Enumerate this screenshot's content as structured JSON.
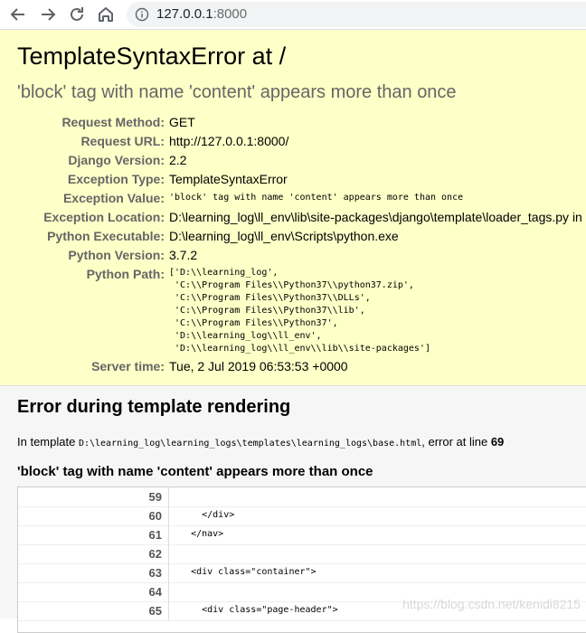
{
  "browser": {
    "url_host": "127.0.0.1",
    "url_port": ":8000",
    "icons": [
      "back-arrow-icon",
      "forward-arrow-icon",
      "reload-icon",
      "home-icon",
      "info-icon"
    ]
  },
  "summary": {
    "title": "TemplateSyntaxError at /",
    "message": "'block' tag with name 'content' appears more than once",
    "rows": [
      {
        "label": "Request Method:",
        "value": "GET"
      },
      {
        "label": "Request URL:",
        "value": "http://127.0.0.1:8000/"
      },
      {
        "label": "Django Version:",
        "value": "2.2"
      },
      {
        "label": "Exception Type:",
        "value": "TemplateSyntaxError"
      },
      {
        "label": "Exception Value:",
        "value": "'block' tag with name 'content' appears more than once"
      },
      {
        "label": "Exception Location:",
        "value": "D:\\learning_log\\ll_env\\lib\\site-packages\\django\\template\\loader_tags.py in"
      },
      {
        "label": "Python Executable:",
        "value": "D:\\learning_log\\ll_env\\Scripts\\python.exe"
      },
      {
        "label": "Python Version:",
        "value": "3.7.2"
      }
    ],
    "python_path_label": "Python Path:",
    "python_path": "['D:\\\\learning_log',\n 'C:\\\\Program Files\\\\Python37\\\\python37.zip',\n 'C:\\\\Program Files\\\\Python37\\\\DLLs',\n 'C:\\\\Program Files\\\\Python37\\\\lib',\n 'C:\\\\Program Files\\\\Python37',\n 'D:\\\\learning_log\\\\ll_env',\n 'D:\\\\learning_log\\\\ll_env\\\\lib\\\\site-packages']",
    "server_time_label": "Server time:",
    "server_time": "Tue, 2 Jul 2019 06:53:53 +0000"
  },
  "template": {
    "heading": "Error during template rendering",
    "intro_prefix": "In template ",
    "template_path": "D:\\learning_log\\learning_logs\\templates\\learning_logs\\base.html",
    "intro_suffix": ", error at line ",
    "error_line": "69",
    "subheading": "'block' tag with name 'content' appears more than once",
    "lines": [
      {
        "num": "59",
        "code": ""
      },
      {
        "num": "60",
        "code": "      </div>"
      },
      {
        "num": "61",
        "code": "    </nav>"
      },
      {
        "num": "62",
        "code": ""
      },
      {
        "num": "63",
        "code": "    <div class=\"container\">"
      },
      {
        "num": "64",
        "code": ""
      },
      {
        "num": "65",
        "code": "      <div class=\"page-header\">"
      }
    ]
  },
  "watermark": "https://blog.csdn.net/kenidi8215"
}
